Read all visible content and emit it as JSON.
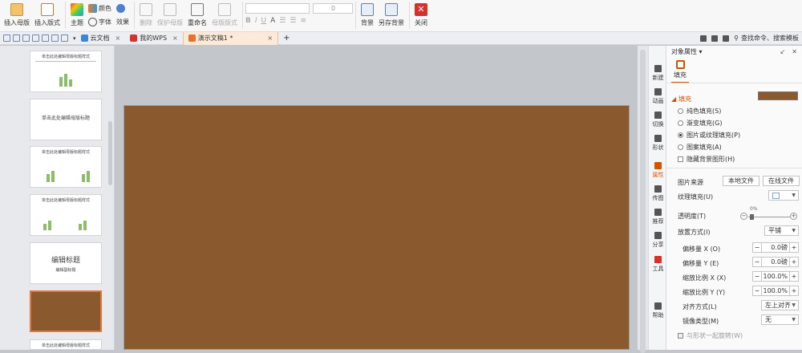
{
  "ribbon": {
    "insert_master": "插入母版",
    "insert_layout": "插入版式",
    "theme": "主题",
    "color": "颜色",
    "font": "字体",
    "effect": "效果",
    "delete": "删除",
    "protect_master": "保护母版",
    "rename": "重命名",
    "master_layout": "母版版式",
    "font_size": "0",
    "bold": "B",
    "italic": "I",
    "underline": "U",
    "font_color": "A",
    "background": "背景",
    "save_background": "另存背景",
    "close": "关闭"
  },
  "tabs": {
    "items": [
      "云文档",
      "我的WPS",
      "演示文稿1 *"
    ],
    "right_search": "查找命令、搜索模板"
  },
  "thumbs": [
    {
      "title": "单击此处编辑母版标题样式"
    },
    {
      "title": "单击此处编辑母版标题"
    },
    {
      "title": "单击此处编辑母版标题样式"
    },
    {
      "title": "单击此处编辑母版标题样式"
    },
    {
      "title": "编辑标题",
      "subtitle": "编辑副标题"
    },
    {
      "title": ""
    },
    {
      "title": "单击此处编辑母版标题样式"
    }
  ],
  "sidestrip": [
    "新建",
    "动画",
    "切换",
    "形状",
    "属性",
    "传图",
    "推荐",
    "分享",
    "工具",
    "帮助"
  ],
  "props": {
    "header": "对象属性 ▾",
    "fill_tab": "填充",
    "section": "填充",
    "options": [
      "纯色填充(S)",
      "渐变填充(G)",
      "图片或纹理填充(P)",
      "图案填充(A)"
    ],
    "hide_bg": "隐藏背景图形(H)",
    "picture_source": "图片来源",
    "local_file": "本地文件",
    "online_file": "在线文件",
    "texture_fill": "纹理填充(U)",
    "transparency": "透明度(T)",
    "transparency_pct": "0%",
    "placement": "放置方式(I)",
    "placement_value": "平铺",
    "offset_x": "偏移量 X (O)",
    "offset_x_value": "0.0磅",
    "offset_y": "偏移量 Y (E)",
    "offset_y_value": "0.0磅",
    "scale_x": "缩放比例 X (X)",
    "scale_x_value": "100.0%",
    "scale_y": "缩放比例 Y (Y)",
    "scale_y_value": "100.0%",
    "align": "对齐方式(L)",
    "align_value": "左上对齐",
    "mirror": "镜像类型(M)",
    "mirror_value": "无",
    "rotate_with": "与形状一起旋转(W)"
  }
}
